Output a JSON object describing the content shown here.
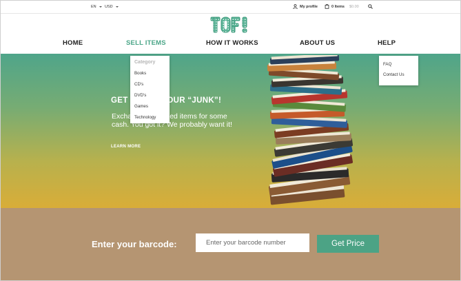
{
  "topbar": {
    "language": "EN",
    "currency": "USD",
    "my_profile": "My profile",
    "cart_count": "0 Items",
    "cart_total": "$0.00"
  },
  "logo": {
    "text": "TOFI",
    "color": "#4aa587"
  },
  "nav": {
    "items": [
      {
        "label": "HOME"
      },
      {
        "label": "SELL ITEMS"
      },
      {
        "label": "HOW IT WORKS"
      },
      {
        "label": "ABOUT US"
      },
      {
        "label": "HELP"
      }
    ],
    "active_index": 1
  },
  "sell_dropdown": {
    "header": "Category",
    "items": [
      "Books",
      "CD's",
      "DVD's",
      "Games",
      "Technology"
    ]
  },
  "help_dropdown": {
    "items": [
      "FAQ",
      "Contact Us"
    ]
  },
  "hero": {
    "title_start": "GET",
    "title_end": "R YOUR “JUNK”!",
    "subtitle_start": "Excha",
    "subtitle_middle": "nwanted items for",
    "subtitle_rest": "some cash. You got it? We probably want it!",
    "learn_more": "LEARN MORE"
  },
  "barcode": {
    "label": "Enter your barcode:",
    "placeholder": "Enter your barcode number",
    "button": "Get Price"
  },
  "colors": {
    "accent": "#4aa587",
    "band": "#b59572"
  }
}
